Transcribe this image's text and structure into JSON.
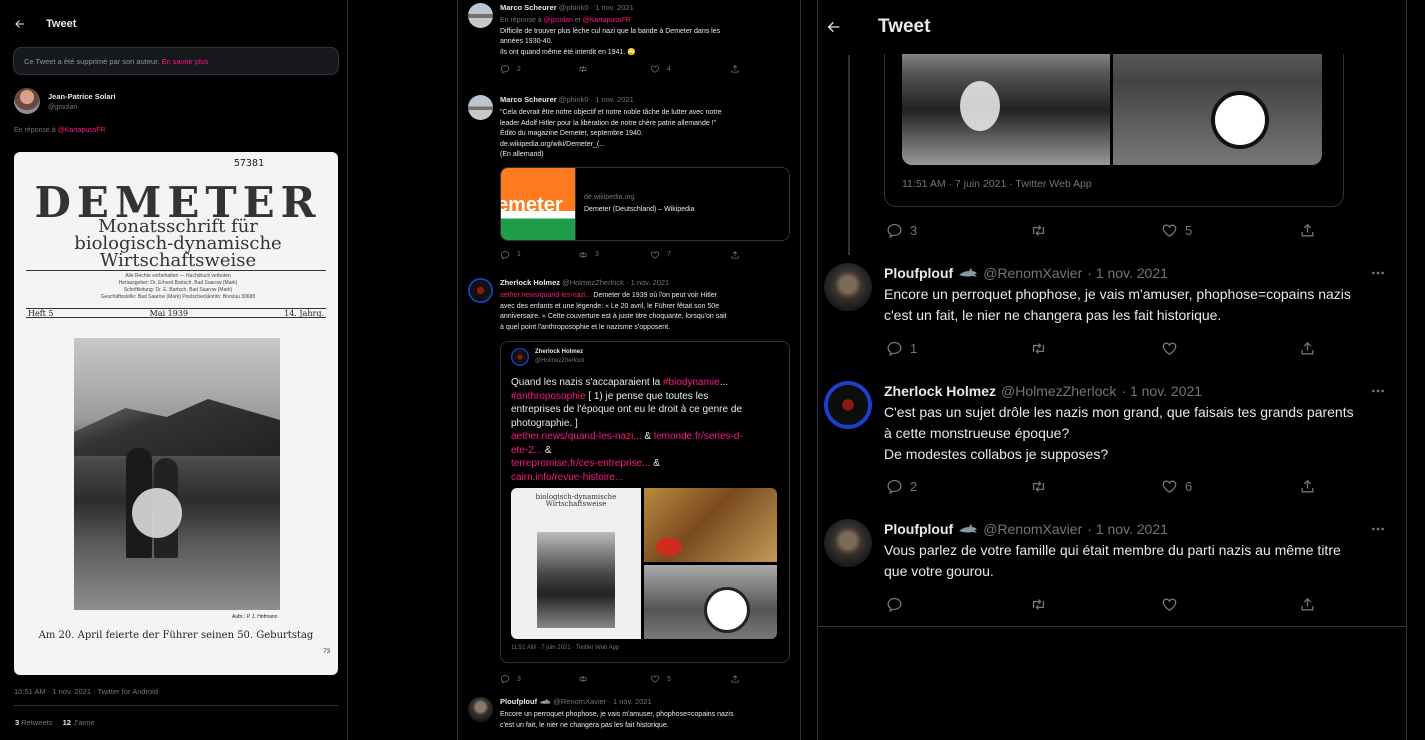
{
  "pane1": {
    "header_title": "Tweet",
    "deleted_notice": "Ce Tweet a été supprimé par son auteur.",
    "learn_more": "En savoir plus",
    "author_name": "Jean-Patrice Solari",
    "author_handle": "@jpsolari",
    "reply_prefix": "En réponse à",
    "reply_to": "@KartapussFR",
    "magazine": {
      "number": "57381",
      "title": "DEMETER",
      "sub1": "Monatsschrift für",
      "sub2": "biologisch-dynamische",
      "sub3": "Wirtschaftsweise",
      "small1": "Alle Rechte vorbehalten — Nachdruck verboten",
      "small2": "Herausgeber: Dr. Erhard Bartsch, Bad Saarow (Mark)",
      "small3": "Schriftleitung: Dr. E. Bartsch, Bad Saarow (Mark)",
      "small4": "Geschäftsstelle: Bad Saarow (Mark)     Postscheckkonto: Breslau 30688",
      "issue": "Heft 5",
      "month": "Mai 1939",
      "year": "14. Jahrg.",
      "credit": "Aufn.: P. J. Hofmann",
      "caption": "Am 20. April feierte der Führer seinen 50. Geburtstag",
      "page": "73"
    },
    "timestamp": "10:51 AM · 1 nov. 2021 · Twitter for Android",
    "retweets_count": "3",
    "retweets_label": "Retweets",
    "likes_count": "12",
    "likes_label": "J'aime"
  },
  "pane2": {
    "tweet1": {
      "name": "Marco Scheurer",
      "handle": "@phink0 · 1 nov. 2021",
      "reply_prefix": "En réponse à",
      "reply_to_1": "@jpsolari",
      "reply_and": "et",
      "reply_to_2": "@KartapussFR",
      "line1": "Difficile de trouver plus lèche cul nazi que la bande à Demeter dans les",
      "line2": "années 1930-40.",
      "line3": "Ils ont quand même été interdit en 1941. 🙄",
      "replies": "2",
      "likes": "4"
    },
    "tweet2": {
      "name": "Marco Scheurer",
      "handle": "@phink0 · 1 nov. 2021",
      "line1": "\"Cela devrait être notre objectif et notre noble tâche de lutter avec notre",
      "line2": "leader Adolf Hitler pour la libération de notre chère patrie allemande !\"",
      "line3": "Édito du magazine Demeter, septembre 1940.",
      "link": "de.wikipedia.org/wiki/Demeter_(...",
      "line4": "(En allemand)",
      "card_thumb": "emeter",
      "card_domain": "de.wikipedia.org",
      "card_title": "Demeter (Deutschland) – Wikipedia",
      "replies": "1",
      "retweets": "3",
      "likes": "7"
    },
    "tweet3": {
      "name": "Zherlock Holmez",
      "handle": "@HolmezZherlock · 1 nov. 2021",
      "link": "aether.news/quand-les-nazi...",
      "line1": " Demeter de 1939 où l'on peut voir Hitler",
      "line2": "avec des enfants et une légende: « Le 20 avril, le Führer fêtait son 50e",
      "line3": "anniversaire. » Cette couverture est à juste titre choquante, lorsqu'on sait",
      "line4": "à quel point l'anthroposophie et le nazisme s'opposent.",
      "quote": {
        "name": "Zherlock Holmez",
        "handle": "@HolmezZherlock",
        "t1": "Quand les nazis s'accaparaient la ",
        "t1_tag": "#biodynamie",
        "t1_end": "...",
        "t2_tag": "#anthroposophie",
        "t2": " [ 1) je pense que toutes les",
        "t3": "entreprises de l'époque ont eu le droit à ce genre de",
        "t4": "photographie. ]",
        "l1": "aether.news/quand-les-nazi...",
        "amp1": " & ",
        "l2": "lemonde.fr/series-d-",
        "l3": "ete-2...",
        "amp2": " &",
        "l4": "terrepromise.fr/ces-entreprise...",
        "amp3": " &",
        "l5": "cairn.info/revue-histoire...",
        "timestamp": "11:51 AM · 7 juin 2021 · Twitter Web App"
      },
      "replies": "3",
      "likes": "5"
    },
    "tweet4": {
      "name": "Ploufplouf",
      "handle": "@RenomXavier · 1 nov. 2021",
      "line1": "Encore un perroquet phophose, je vais m'amuser, phophose=copains nazis",
      "line2": "c'est un fait, le nier ne changera pas les fait historique."
    }
  },
  "pane3": {
    "header_title": "Tweet",
    "quote_timestamp": "11:51 AM · 7 juin 2021 · Twitter Web App",
    "qt_replies": "3",
    "qt_likes": "5",
    "tweet1": {
      "name": "Ploufplouf",
      "handle": "@RenomXavier",
      "date": "· 1 nov. 2021",
      "line1": "Encore un perroquet phophose, je vais m'amuser, phophose=copains nazis",
      "line2": "c'est un fait, le nier ne changera pas les fait historique.",
      "replies": "1"
    },
    "tweet2": {
      "name": "Zherlock Holmez",
      "handle": "@HolmezZherlock",
      "date": "· 1 nov. 2021",
      "line1": "C'est pas un sujet drôle les nazis mon grand, que faisais tes grands parents",
      "line2": "à cette monstrueuse époque?",
      "line3": "De modestes collabos je supposes?",
      "replies": "2",
      "likes": "6"
    },
    "tweet3": {
      "name": "Ploufplouf",
      "handle": "@RenomXavier",
      "date": "· 1 nov. 2021",
      "line1": "Vous parlez de votre famille qui était membre du parti nazis au même titre",
      "line2": "que votre gourou."
    }
  },
  "icons": {
    "back": "arrow-left-icon",
    "reply": "speech-bubble-icon",
    "retweet": "retweet-arrows-icon",
    "like": "heart-icon",
    "share": "share-upload-icon",
    "more": "more-dots-icon",
    "shark": "shark-emoji-icon"
  },
  "colors": {
    "background": "#000000",
    "text": "#e7e9ea",
    "muted": "#71767b",
    "link": "#f91880",
    "border": "#2f3336"
  }
}
